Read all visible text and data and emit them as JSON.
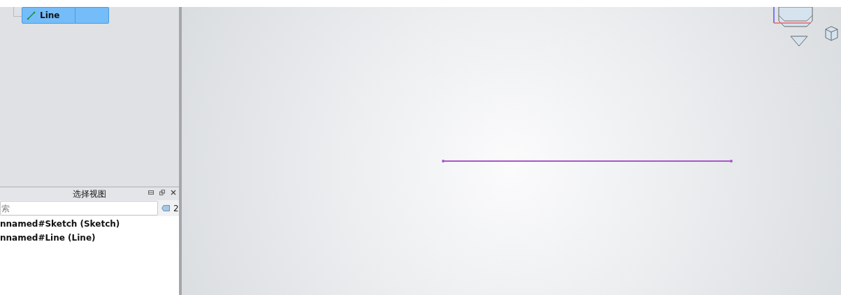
{
  "tree": {
    "items": [
      {
        "label": "Line",
        "selected": true
      }
    ]
  },
  "selection_view": {
    "title": "选择视图",
    "search": {
      "placeholder": "索"
    },
    "count": "2",
    "items": [
      "nnamed#Sketch (Sketch)",
      "nnamed#Line (Line)"
    ]
  }
}
